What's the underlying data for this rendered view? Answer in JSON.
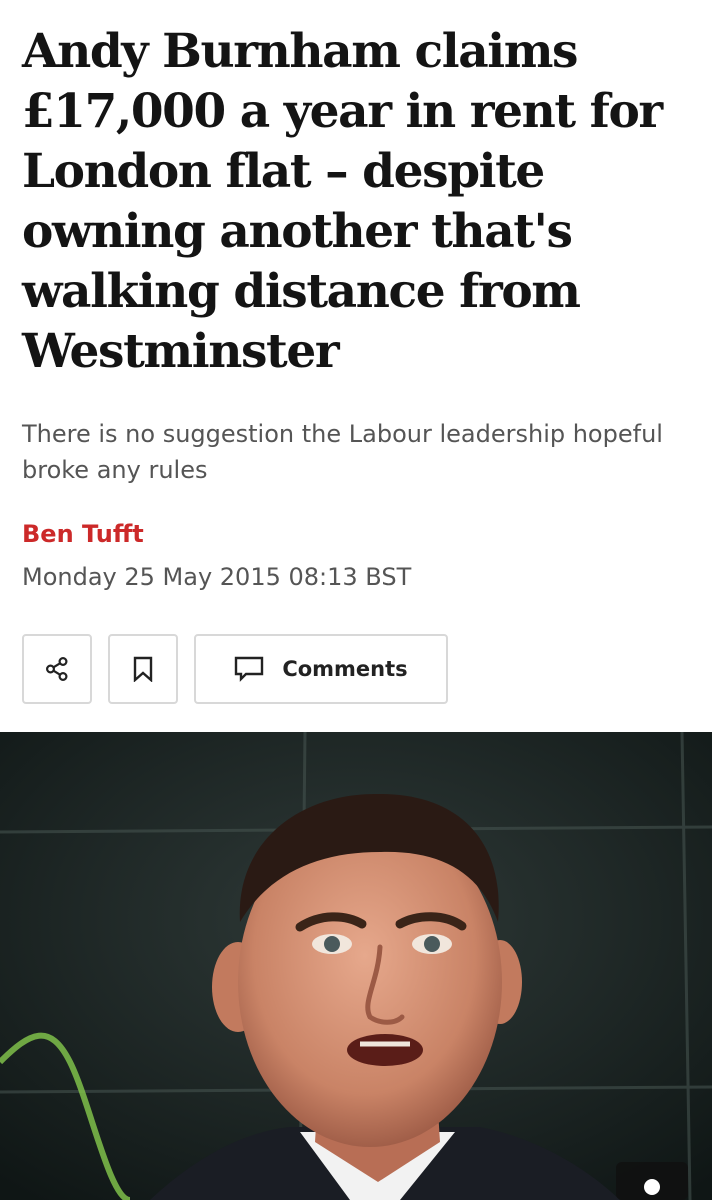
{
  "article": {
    "headline": "Andy Burnham claims £17,000 a year in rent for London flat – despite owning another that's walking distance from Westminster",
    "standfirst": "There is no suggestion the Labour leadership hopeful broke any rules",
    "author": "Ben Tufft",
    "published": "Monday 25 May 2015 08:13 BST"
  },
  "actions": {
    "share_icon": "share-icon",
    "bookmark_icon": "bookmark-icon",
    "comments_icon": "speech-bubble-icon",
    "comments_label": "Comments"
  },
  "colors": {
    "headline": "#141414",
    "byline": "#cc2929",
    "secondary_text": "#555555",
    "button_border": "#d8d8d8"
  }
}
